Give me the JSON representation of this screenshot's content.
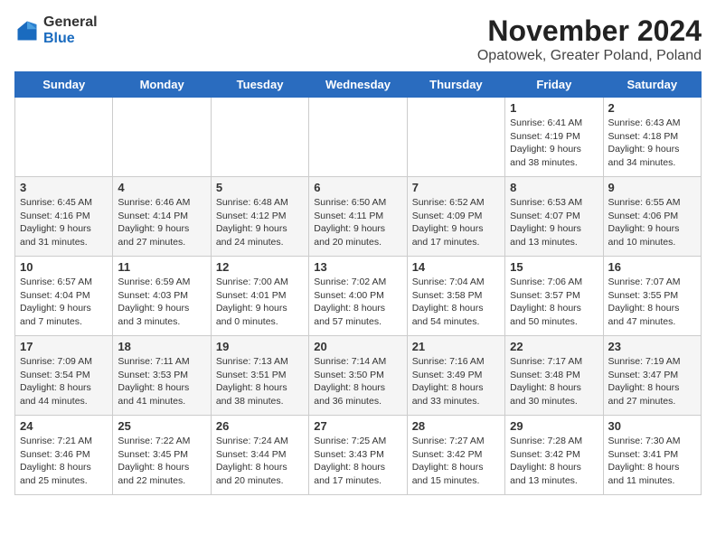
{
  "logo": {
    "general": "General",
    "blue": "Blue"
  },
  "title": "November 2024",
  "subtitle": "Opatowek, Greater Poland, Poland",
  "days_of_week": [
    "Sunday",
    "Monday",
    "Tuesday",
    "Wednesday",
    "Thursday",
    "Friday",
    "Saturday"
  ],
  "weeks": [
    [
      {
        "day": "",
        "info": ""
      },
      {
        "day": "",
        "info": ""
      },
      {
        "day": "",
        "info": ""
      },
      {
        "day": "",
        "info": ""
      },
      {
        "day": "",
        "info": ""
      },
      {
        "day": "1",
        "info": "Sunrise: 6:41 AM\nSunset: 4:19 PM\nDaylight: 9 hours\nand 38 minutes."
      },
      {
        "day": "2",
        "info": "Sunrise: 6:43 AM\nSunset: 4:18 PM\nDaylight: 9 hours\nand 34 minutes."
      }
    ],
    [
      {
        "day": "3",
        "info": "Sunrise: 6:45 AM\nSunset: 4:16 PM\nDaylight: 9 hours\nand 31 minutes."
      },
      {
        "day": "4",
        "info": "Sunrise: 6:46 AM\nSunset: 4:14 PM\nDaylight: 9 hours\nand 27 minutes."
      },
      {
        "day": "5",
        "info": "Sunrise: 6:48 AM\nSunset: 4:12 PM\nDaylight: 9 hours\nand 24 minutes."
      },
      {
        "day": "6",
        "info": "Sunrise: 6:50 AM\nSunset: 4:11 PM\nDaylight: 9 hours\nand 20 minutes."
      },
      {
        "day": "7",
        "info": "Sunrise: 6:52 AM\nSunset: 4:09 PM\nDaylight: 9 hours\nand 17 minutes."
      },
      {
        "day": "8",
        "info": "Sunrise: 6:53 AM\nSunset: 4:07 PM\nDaylight: 9 hours\nand 13 minutes."
      },
      {
        "day": "9",
        "info": "Sunrise: 6:55 AM\nSunset: 4:06 PM\nDaylight: 9 hours\nand 10 minutes."
      }
    ],
    [
      {
        "day": "10",
        "info": "Sunrise: 6:57 AM\nSunset: 4:04 PM\nDaylight: 9 hours\nand 7 minutes."
      },
      {
        "day": "11",
        "info": "Sunrise: 6:59 AM\nSunset: 4:03 PM\nDaylight: 9 hours\nand 3 minutes."
      },
      {
        "day": "12",
        "info": "Sunrise: 7:00 AM\nSunset: 4:01 PM\nDaylight: 9 hours\nand 0 minutes."
      },
      {
        "day": "13",
        "info": "Sunrise: 7:02 AM\nSunset: 4:00 PM\nDaylight: 8 hours\nand 57 minutes."
      },
      {
        "day": "14",
        "info": "Sunrise: 7:04 AM\nSunset: 3:58 PM\nDaylight: 8 hours\nand 54 minutes."
      },
      {
        "day": "15",
        "info": "Sunrise: 7:06 AM\nSunset: 3:57 PM\nDaylight: 8 hours\nand 50 minutes."
      },
      {
        "day": "16",
        "info": "Sunrise: 7:07 AM\nSunset: 3:55 PM\nDaylight: 8 hours\nand 47 minutes."
      }
    ],
    [
      {
        "day": "17",
        "info": "Sunrise: 7:09 AM\nSunset: 3:54 PM\nDaylight: 8 hours\nand 44 minutes."
      },
      {
        "day": "18",
        "info": "Sunrise: 7:11 AM\nSunset: 3:53 PM\nDaylight: 8 hours\nand 41 minutes."
      },
      {
        "day": "19",
        "info": "Sunrise: 7:13 AM\nSunset: 3:51 PM\nDaylight: 8 hours\nand 38 minutes."
      },
      {
        "day": "20",
        "info": "Sunrise: 7:14 AM\nSunset: 3:50 PM\nDaylight: 8 hours\nand 36 minutes."
      },
      {
        "day": "21",
        "info": "Sunrise: 7:16 AM\nSunset: 3:49 PM\nDaylight: 8 hours\nand 33 minutes."
      },
      {
        "day": "22",
        "info": "Sunrise: 7:17 AM\nSunset: 3:48 PM\nDaylight: 8 hours\nand 30 minutes."
      },
      {
        "day": "23",
        "info": "Sunrise: 7:19 AM\nSunset: 3:47 PM\nDaylight: 8 hours\nand 27 minutes."
      }
    ],
    [
      {
        "day": "24",
        "info": "Sunrise: 7:21 AM\nSunset: 3:46 PM\nDaylight: 8 hours\nand 25 minutes."
      },
      {
        "day": "25",
        "info": "Sunrise: 7:22 AM\nSunset: 3:45 PM\nDaylight: 8 hours\nand 22 minutes."
      },
      {
        "day": "26",
        "info": "Sunrise: 7:24 AM\nSunset: 3:44 PM\nDaylight: 8 hours\nand 20 minutes."
      },
      {
        "day": "27",
        "info": "Sunrise: 7:25 AM\nSunset: 3:43 PM\nDaylight: 8 hours\nand 17 minutes."
      },
      {
        "day": "28",
        "info": "Sunrise: 7:27 AM\nSunset: 3:42 PM\nDaylight: 8 hours\nand 15 minutes."
      },
      {
        "day": "29",
        "info": "Sunrise: 7:28 AM\nSunset: 3:42 PM\nDaylight: 8 hours\nand 13 minutes."
      },
      {
        "day": "30",
        "info": "Sunrise: 7:30 AM\nSunset: 3:41 PM\nDaylight: 8 hours\nand 11 minutes."
      }
    ]
  ]
}
